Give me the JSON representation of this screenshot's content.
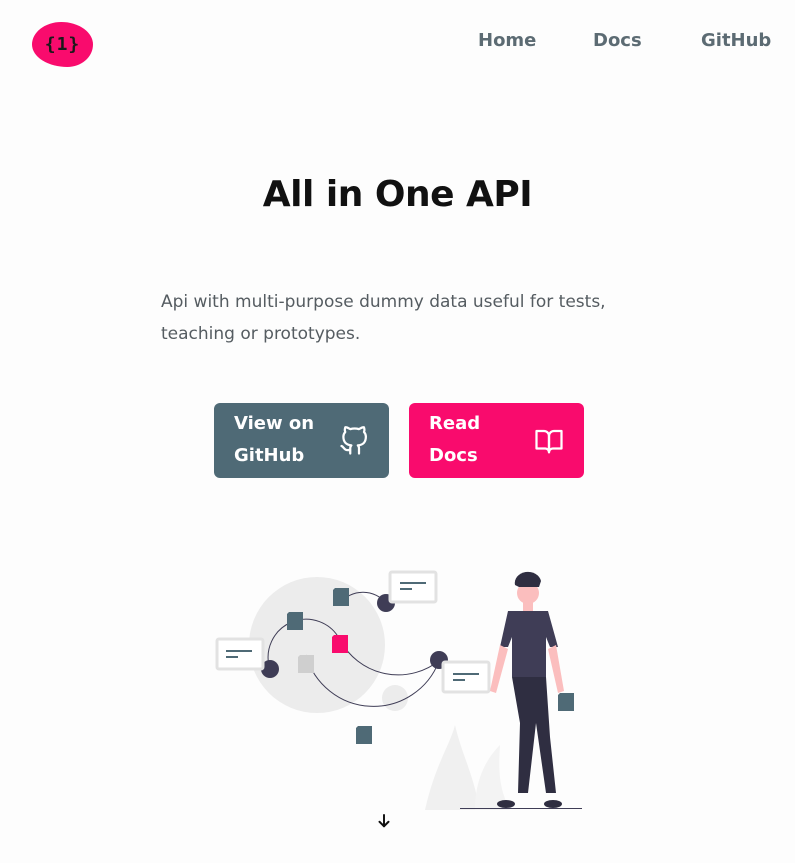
{
  "header": {
    "logo_text": "{1}",
    "nav": [
      {
        "label": "Home"
      },
      {
        "label": "Docs"
      },
      {
        "label": "GitHub"
      }
    ]
  },
  "hero": {
    "title": "All in One API",
    "description": "Api with multi-purpose dummy data useful for tests, teaching or prototypes.",
    "buttons": {
      "github": {
        "label": "View on GitHub",
        "icon": "github-icon"
      },
      "docs": {
        "label": "Read Docs",
        "icon": "book-icon"
      }
    },
    "scroll_icon": "arrow-down-icon"
  },
  "colors": {
    "accent": "#f90b6d",
    "slate": "#4f6a76",
    "nav_text": "#5c6b73",
    "figure_dark": "#3f3d56"
  }
}
